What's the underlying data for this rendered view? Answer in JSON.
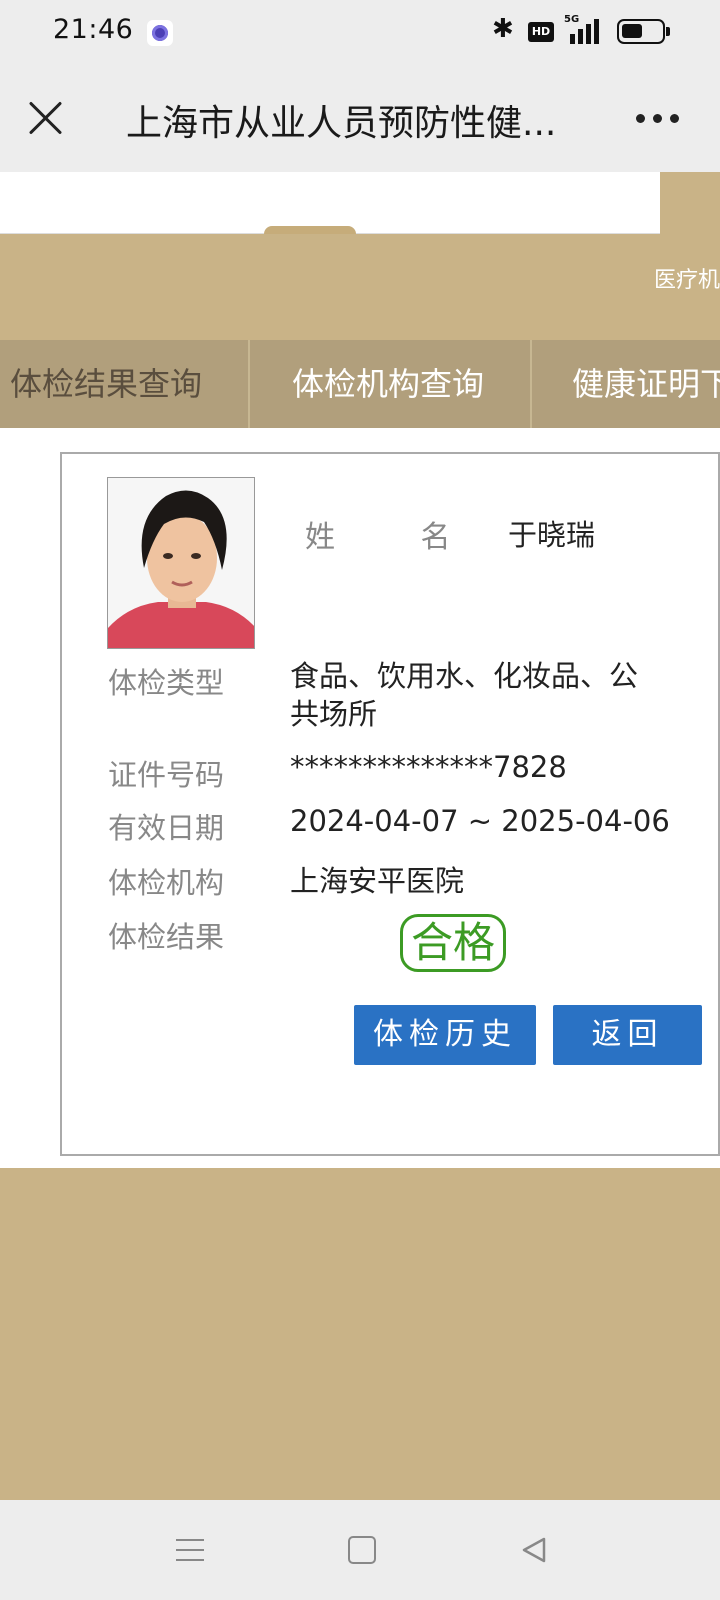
{
  "status_bar": {
    "time": "21:46",
    "bluetooth_icon": "bluetooth-icon",
    "hd_label": "HD",
    "network_label": "5G",
    "battery_level": 0.55
  },
  "title_bar": {
    "title": "上海市从业人员预防性健..."
  },
  "banner": {
    "text": "医疗机"
  },
  "nav_tabs": [
    {
      "label": "体检结果查询"
    },
    {
      "label": "体检机构查询"
    },
    {
      "label": "健康证明下"
    }
  ],
  "record": {
    "name_label": "姓 名",
    "name_value": "于晓瑞",
    "type_label": "体检类型",
    "type_value": "食品、饮用水、化妆品、公共场所",
    "id_label": "证件号码",
    "id_value": "**************7828",
    "validity_label": "有效日期",
    "validity_value": "2024-04-07 ~ 2025-04-06",
    "institution_label": "体检机构",
    "institution_value": "上海安平医院",
    "result_label": "体检结果",
    "result_value": "合格"
  },
  "buttons": {
    "history": "体检历史",
    "back": "返回"
  },
  "colors": {
    "gold": "#c9b387",
    "nav_bg": "#b19f7c",
    "button_blue": "#2a72c4",
    "stamp_green": "#3c9b24"
  }
}
